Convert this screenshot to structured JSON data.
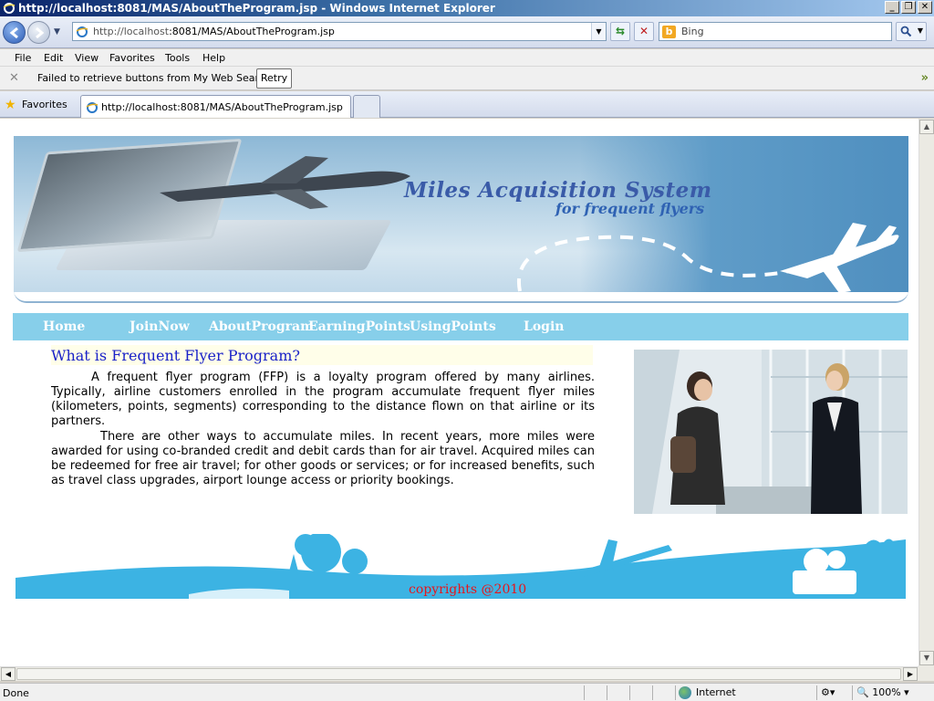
{
  "window": {
    "title": "http://localhost:8081/MAS/AboutTheProgram.jsp - Windows Internet Explorer",
    "buttons": [
      "_",
      "❐",
      "✕"
    ]
  },
  "address": {
    "url_prefix": "http://localhost",
    "url_rest": ":8081/MAS/AboutTheProgram.jsp",
    "search_placeholder": "Bing"
  },
  "menu": [
    "File",
    "Edit",
    "View",
    "Favorites",
    "Tools",
    "Help"
  ],
  "messagebar": {
    "text": "Failed to retrieve buttons from My Web Search.",
    "retry_label": "Retry"
  },
  "favorites": {
    "label": "Favorites",
    "tab_title": "http://localhost:8081/MAS/AboutTheProgram.jsp"
  },
  "site": {
    "banner_title": "Miles Acquisition System",
    "banner_subtitle": "for frequent flyers",
    "nav": [
      "Home",
      "JoinNow",
      "AboutProgram",
      "EarningPoints",
      "UsingPoints",
      "Login"
    ],
    "heading": "What is Frequent Flyer Program?",
    "paragraph1": "A frequent flyer program (FFP) is a loyalty program offered by many airlines. Typically, airline customers enrolled in the program accumulate frequent flyer miles (kilometers, points, segments) corresponding to the distance flown on that airline or its partners.",
    "paragraph2": "There are other ways to accumulate miles. In recent years, more miles were awarded for using co-branded credit and debit cards than for air travel. Acquired miles can be redeemed for free air travel; for other goods or services; or for increased benefits, such as travel class upgrades, airport lounge access or priority bookings.",
    "copyright": "copyrights @2010"
  },
  "status": {
    "text": "Done",
    "zone": "Internet",
    "zoom": "100%"
  },
  "colors": {
    "nav_bg": "#87cfea",
    "heading": "#1a22c8",
    "copyright": "#e8151b",
    "footer_silhouette": "#3cb3e3"
  }
}
